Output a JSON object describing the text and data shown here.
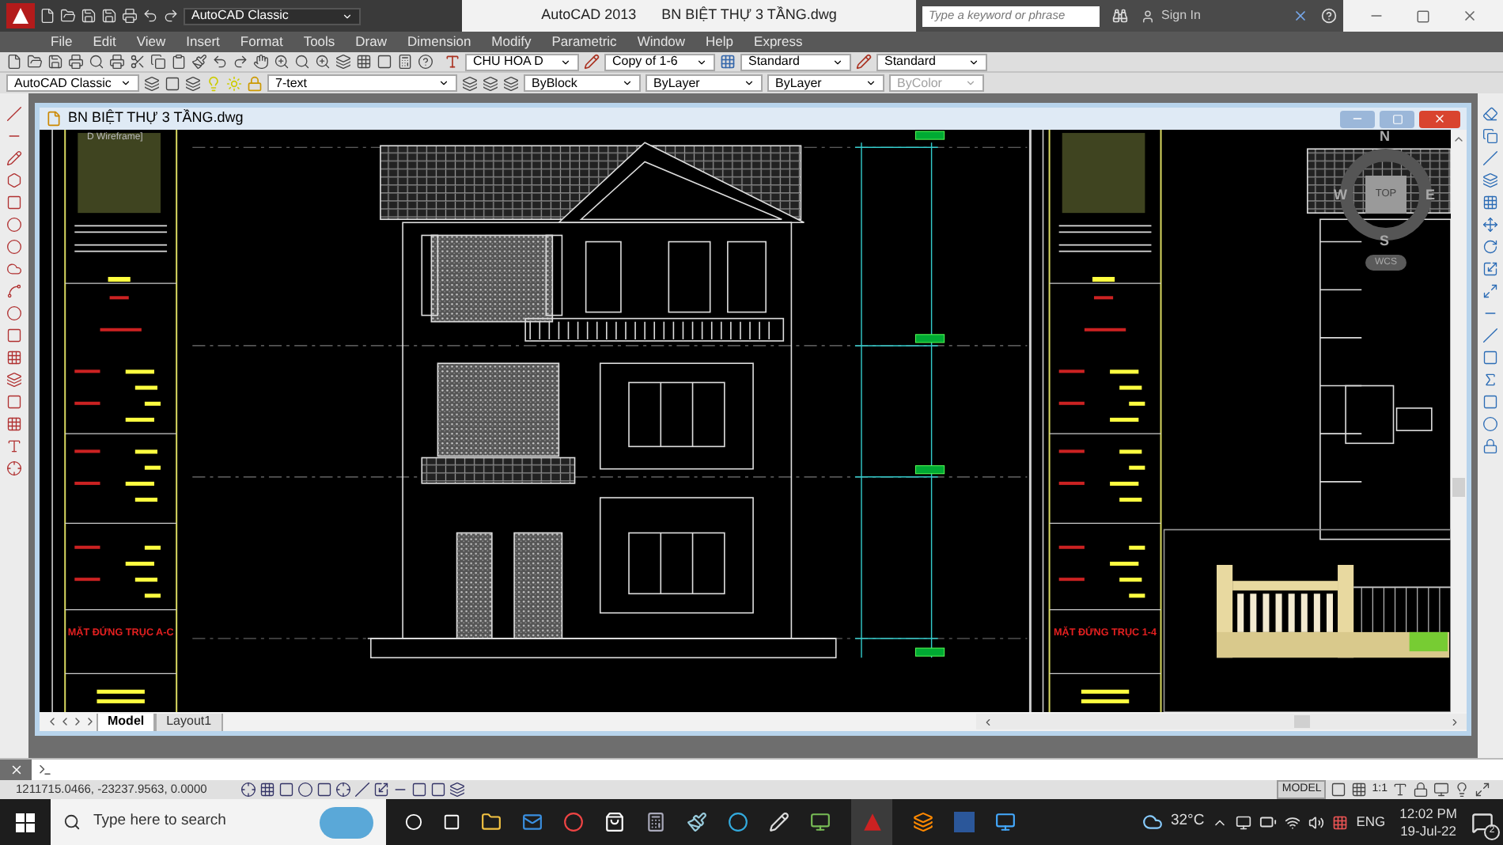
{
  "title_bar": {
    "app_title": "AutoCAD 2013",
    "document_title": "BN BIỆT THỰ 3 TẦNG.dwg",
    "workspace": "AutoCAD Classic",
    "search_placeholder": "Type a keyword or phrase",
    "sign_in": "Sign In"
  },
  "menu": [
    "File",
    "Edit",
    "View",
    "Insert",
    "Format",
    "Tools",
    "Draw",
    "Dimension",
    "Modify",
    "Parametric",
    "Window",
    "Help",
    "Express"
  ],
  "styles_toolbar": {
    "text_style": "CHU HOA D",
    "dim_style": "Copy of 1-6",
    "table_style": "Standard",
    "multileader_style": "Standard"
  },
  "properties_toolbar": {
    "workspace": "AutoCAD Classic",
    "layer": "7-text",
    "color_control": "ByBlock",
    "linetype": "ByLayer",
    "lineweight": "ByLayer",
    "plot_style": {
      "value": "ByColor",
      "disabled": true
    }
  },
  "drawing_window": {
    "title": "BN BIỆT THỰ 3 TẦNG.dwg",
    "viewport_label": "D Wireframe]",
    "sheets": [
      {
        "title": "MẶT ĐỨNG TRỤC A-C"
      },
      {
        "title": "MẶT ĐỨNG TRỤC 1-4"
      }
    ],
    "view_cube": {
      "north": "N",
      "west": "W",
      "east": "E",
      "south": "S",
      "face": "TOP",
      "ucs": "WCS"
    },
    "layout_tabs": [
      {
        "label": "Model",
        "selected": true
      },
      {
        "label": "Layout1",
        "selected": false
      }
    ]
  },
  "status_bar": {
    "coordinates": "1211715.0466, -23237.9563, 0.0000",
    "space": "MODEL",
    "annotation_scale": "1:1"
  },
  "taskbar": {
    "search_placeholder": "Type here to search",
    "temperature": "32°C",
    "language": "ENG",
    "time": "12:02 PM",
    "date": "19-Jul-22",
    "notifications": "2"
  }
}
